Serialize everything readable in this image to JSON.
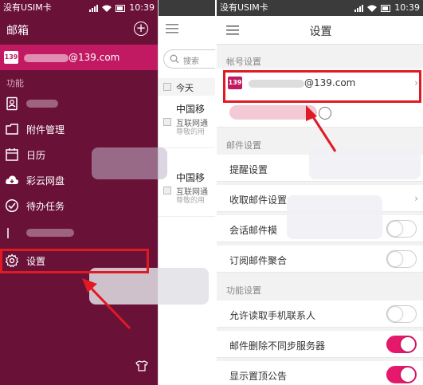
{
  "status_bar": {
    "carrier": "没有USIM卡",
    "time": "10:39"
  },
  "drawer": {
    "title": "邮箱",
    "account": {
      "logo": "139",
      "email_suffix": "@139.com"
    },
    "section_label": "功能",
    "items": [
      {
        "label": "",
        "icon": "contacts-icon"
      },
      {
        "label": "附件管理",
        "icon": "attachment-icon"
      },
      {
        "label": "日历",
        "icon": "calendar-icon"
      },
      {
        "label": "彩云网盘",
        "icon": "cloud-icon"
      },
      {
        "label": "待办任务",
        "icon": "task-check-icon"
      },
      {
        "label": "",
        "icon": "edit-icon"
      },
      {
        "label": "设置",
        "icon": "gear-icon"
      }
    ]
  },
  "mail_list": {
    "search_placeholder": "搜索",
    "group_label": "今天",
    "mails": [
      {
        "subject": "中国移",
        "from": "互联网通",
        "preview": "尊敬的用"
      },
      {
        "subject": "中国移",
        "from": "互联网通",
        "preview": "尊敬的用"
      }
    ]
  },
  "settings": {
    "title": "设置",
    "account_section": "帐号设置",
    "account": {
      "logo": "139",
      "email_suffix": "@139.com"
    },
    "mail_section": "邮件设置",
    "mail_rows": [
      {
        "label": "提醒设置",
        "control": "none"
      },
      {
        "label": "收取邮件设置",
        "control": "chevron"
      },
      {
        "label": "会话邮件模",
        "control": "toggle",
        "on": false
      },
      {
        "label": "订阅邮件聚合",
        "control": "toggle",
        "on": false
      }
    ],
    "function_section": "功能设置",
    "function_rows": [
      {
        "label": "允许读取手机联系人",
        "on": false
      },
      {
        "label": "邮件删除不同步服务器",
        "on": true
      },
      {
        "label": "显示置顶公告",
        "on": true
      }
    ]
  },
  "colors": {
    "drawer_bg": "#6a1138",
    "accent": "#c11a62",
    "toggle_on": "#e6186b",
    "highlight": "#e01a22"
  }
}
